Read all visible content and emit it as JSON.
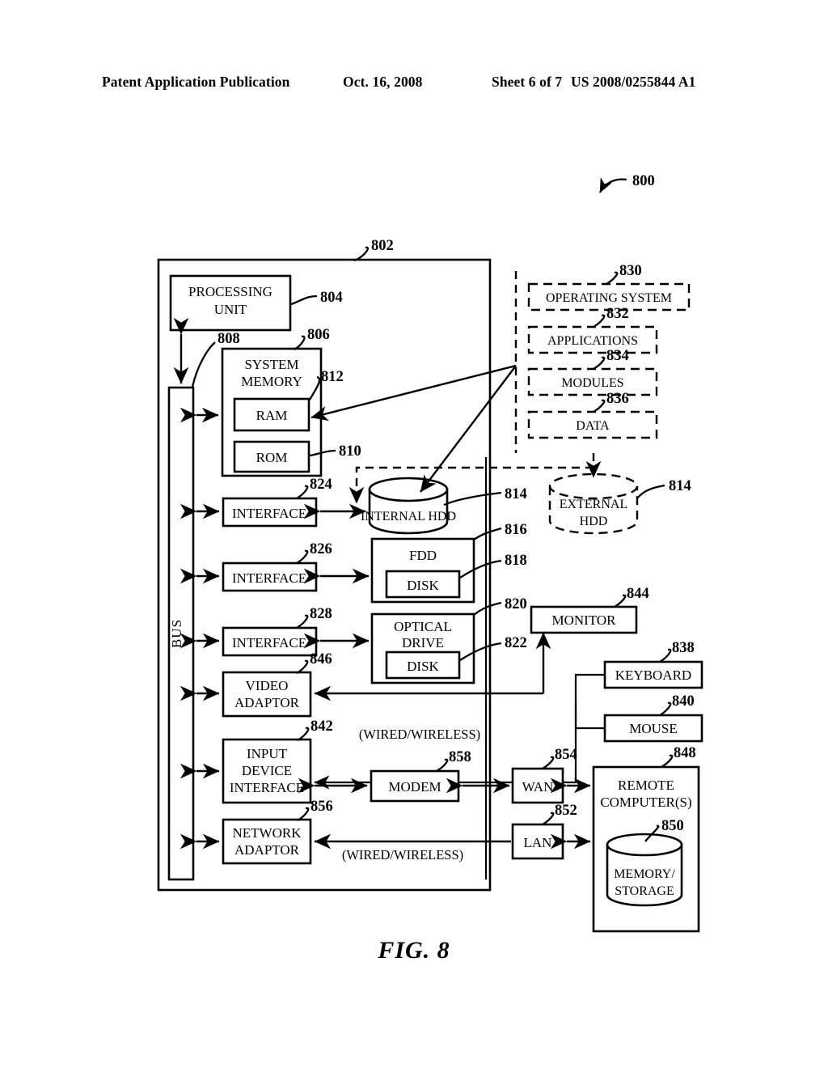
{
  "header": {
    "publication": "Patent Application Publication",
    "date": "Oct. 16, 2008",
    "sheet": "Sheet 6 of 7",
    "document_number": "US 2008/0255844 A1"
  },
  "figure": {
    "caption": "FIG. 8",
    "system_ref": "800"
  },
  "diagram": {
    "computer_enclosure": {
      "ref": "802"
    },
    "bus": {
      "label": "BUS",
      "ref": "808"
    },
    "blocks": [
      {
        "id": "processing-unit",
        "label": "PROCESSING UNIT",
        "ref": "804"
      },
      {
        "id": "system-memory",
        "label": "SYSTEM MEMORY",
        "ref": "806"
      },
      {
        "id": "ram",
        "label": "RAM",
        "ref": "812"
      },
      {
        "id": "rom",
        "label": "ROM",
        "ref": "810"
      },
      {
        "id": "interface-hdd",
        "label": "INTERFACE",
        "ref": "824"
      },
      {
        "id": "interface-fdd",
        "label": "INTERFACE",
        "ref": "826"
      },
      {
        "id": "interface-optical",
        "label": "INTERFACE",
        "ref": "828"
      },
      {
        "id": "internal-hdd",
        "label": "INTERNAL HDD",
        "ref": "814"
      },
      {
        "id": "external-hdd",
        "label": "EXTERNAL HDD",
        "ref": "814"
      },
      {
        "id": "fdd",
        "label": "FDD",
        "ref": "816"
      },
      {
        "id": "fdd-disk",
        "label": "DISK",
        "ref": "818"
      },
      {
        "id": "optical-drive",
        "label": "OPTICAL DRIVE",
        "ref": "820"
      },
      {
        "id": "optical-disk",
        "label": "DISK",
        "ref": "822"
      },
      {
        "id": "video-adaptor",
        "label": "VIDEO ADAPTOR",
        "ref": "846"
      },
      {
        "id": "monitor",
        "label": "MONITOR",
        "ref": "844"
      },
      {
        "id": "keyboard",
        "label": "KEYBOARD",
        "ref": "838"
      },
      {
        "id": "mouse",
        "label": "MOUSE",
        "ref": "840"
      },
      {
        "id": "input-device-interface",
        "label": "INPUT DEVICE INTERFACE",
        "ref": "842"
      },
      {
        "id": "network-adaptor",
        "label": "NETWORK ADAPTOR",
        "ref": "856"
      },
      {
        "id": "modem",
        "label": "MODEM",
        "ref": "858"
      },
      {
        "id": "wan",
        "label": "WAN",
        "ref": "854"
      },
      {
        "id": "lan",
        "label": "LAN",
        "ref": "852"
      },
      {
        "id": "remote-computers",
        "label": "REMOTE COMPUTER(S)",
        "ref": "848"
      },
      {
        "id": "memory-storage",
        "label": "MEMORY/ STORAGE",
        "ref": "850"
      }
    ],
    "software_blocks": [
      {
        "id": "operating-system",
        "label": "OPERATING SYSTEM",
        "ref": "830"
      },
      {
        "id": "applications",
        "label": "APPLICATIONS",
        "ref": "832"
      },
      {
        "id": "modules",
        "label": "MODULES",
        "ref": "834"
      },
      {
        "id": "data",
        "label": "DATA",
        "ref": "836"
      }
    ],
    "annotations": [
      {
        "id": "wired-wireless-input",
        "label": "(WIRED/WIRELESS)"
      },
      {
        "id": "wired-wireless-network",
        "label": "(WIRED/WIRELESS)"
      }
    ],
    "text": {
      "processing_unit_l1": "PROCESSING",
      "processing_unit_l2": "UNIT",
      "system_memory_l1": "SYSTEM",
      "system_memory_l2": "MEMORY",
      "ram": "RAM",
      "rom": "ROM",
      "interface": "INTERFACE",
      "internal_hdd": "INTERNAL HDD",
      "external_hdd_l1": "EXTERNAL",
      "external_hdd_l2": "HDD",
      "fdd": "FDD",
      "disk": "DISK",
      "optical_drive_l1": "OPTICAL",
      "optical_drive_l2": "DRIVE",
      "video_adaptor_l1": "VIDEO",
      "video_adaptor_l2": "ADAPTOR",
      "monitor": "MONITOR",
      "keyboard": "KEYBOARD",
      "mouse": "MOUSE",
      "input_device_l1": "INPUT",
      "input_device_l2": "DEVICE",
      "input_device_l3": "INTERFACE",
      "network_adaptor_l1": "NETWORK",
      "network_adaptor_l2": "ADAPTOR",
      "modem": "MODEM",
      "wan": "WAN",
      "lan": "LAN",
      "remote_l1": "REMOTE",
      "remote_l2": "COMPUTER(S)",
      "memory_storage_l1": "MEMORY/",
      "memory_storage_l2": "STORAGE",
      "operating_system": "OPERATING SYSTEM",
      "applications": "APPLICATIONS",
      "modules": "MODULES",
      "data": "DATA",
      "bus": "BUS",
      "wired_wireless": "(WIRED/WIRELESS)"
    },
    "refs": {
      "r800": "800",
      "r802": "802",
      "r804": "804",
      "r806": "806",
      "r808": "808",
      "r810": "810",
      "r812": "812",
      "r814a": "814",
      "r814b": "814",
      "r816": "816",
      "r818": "818",
      "r820": "820",
      "r822": "822",
      "r824": "824",
      "r826": "826",
      "r828": "828",
      "r830": "830",
      "r832": "832",
      "r834": "834",
      "r836": "836",
      "r838": "838",
      "r840": "840",
      "r842": "842",
      "r844": "844",
      "r846": "846",
      "r848": "848",
      "r850": "850",
      "r852": "852",
      "r854": "854",
      "r856": "856",
      "r858": "858"
    }
  }
}
